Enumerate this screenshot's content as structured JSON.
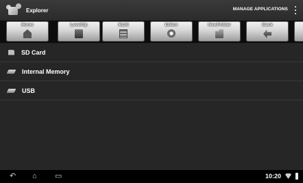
{
  "app": {
    "title": "Explorer"
  },
  "action_bar": {
    "manage_label": "MANAGE APPLICATIONS"
  },
  "toolbar": {
    "buttons": [
      {
        "label": "Home",
        "icon": "home-icon"
      },
      {
        "label": "LevelUp",
        "icon": "level-up-icon"
      },
      {
        "label": "Multi",
        "icon": "multi-select-icon"
      },
      {
        "label": "Editor",
        "icon": "editor-icon"
      },
      {
        "label": "NewFolder",
        "icon": "new-folder-icon"
      },
      {
        "label": "Back",
        "icon": "back-icon"
      }
    ]
  },
  "list": {
    "items": [
      {
        "label": "SD Card",
        "icon": "sd-card-icon"
      },
      {
        "label": "Internal Memory",
        "icon": "internal-memory-icon"
      },
      {
        "label": "USB",
        "icon": "usb-icon"
      }
    ]
  },
  "status": {
    "time": "10:20",
    "icons": [
      "back-nav-icon",
      "home-nav-icon",
      "recents-nav-icon",
      "wifi-icon",
      "battery-icon"
    ]
  },
  "colors": {
    "background": "#262626",
    "toolbar_bg": "#0d0d0d",
    "text": "#ffffff"
  }
}
